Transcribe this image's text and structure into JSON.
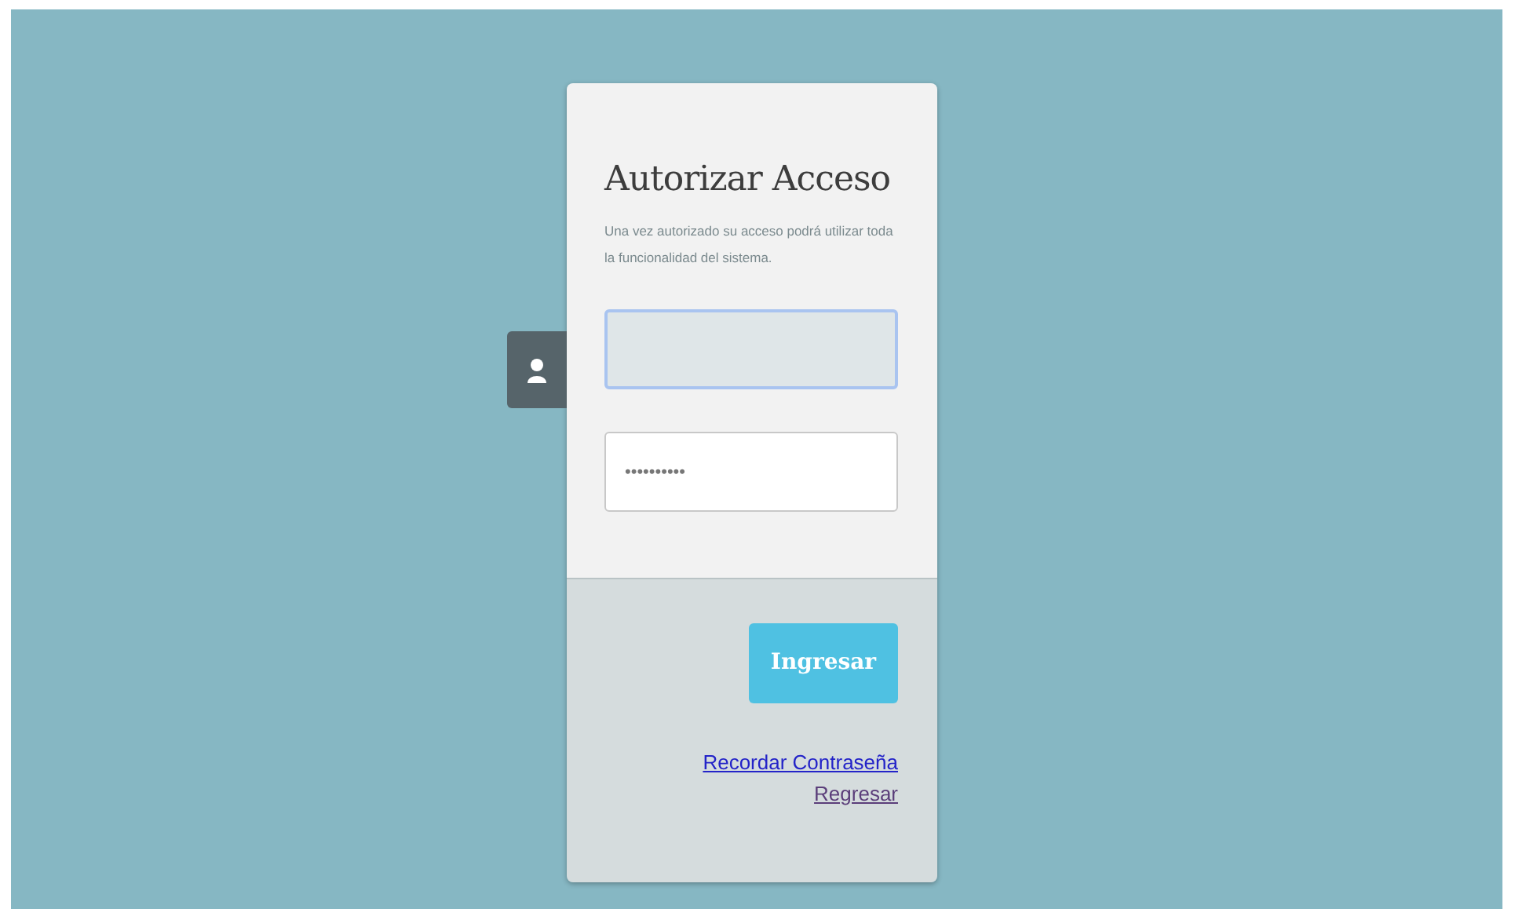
{
  "login": {
    "title": "Autorizar Acceso",
    "description": "Una vez autorizado su acceso podrá utilizar toda la funcionalidad del sistema.",
    "username": {
      "focused": true
    },
    "password": {
      "value": "••••••••••",
      "focused": false
    },
    "submit": "Ingresar",
    "links": [
      {
        "label": "Recordar Contraseña",
        "visited": false
      },
      {
        "label": "Regresar",
        "visited": true
      }
    ]
  }
}
